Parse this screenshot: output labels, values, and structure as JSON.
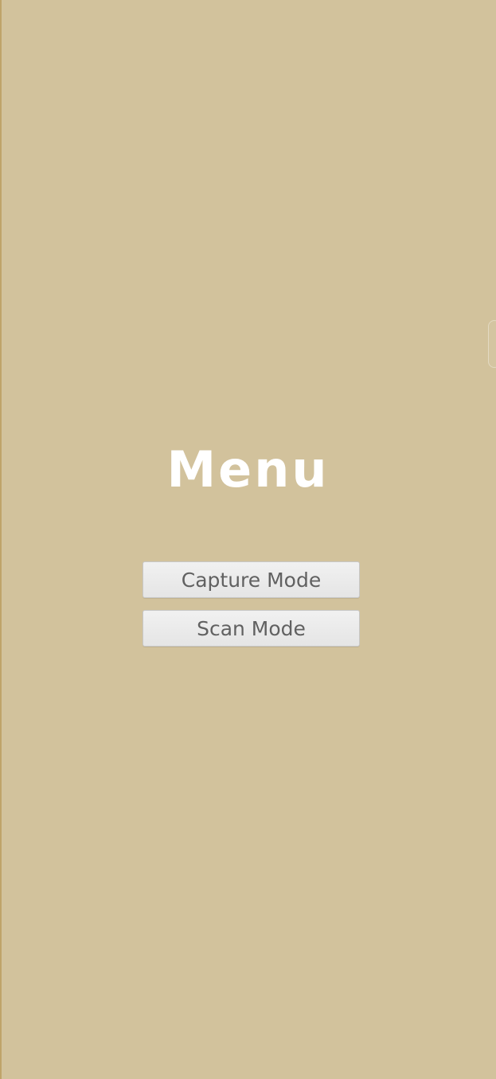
{
  "screen": {
    "background_color": "#d2c29c",
    "accent_edge_color": "#bfa46a"
  },
  "menu": {
    "title": "Menu",
    "buttons": [
      {
        "label": "Capture Mode"
      },
      {
        "label": "Scan Mode"
      }
    ]
  },
  "icons": {
    "right_edge_handle": "edge-handle-icon"
  }
}
